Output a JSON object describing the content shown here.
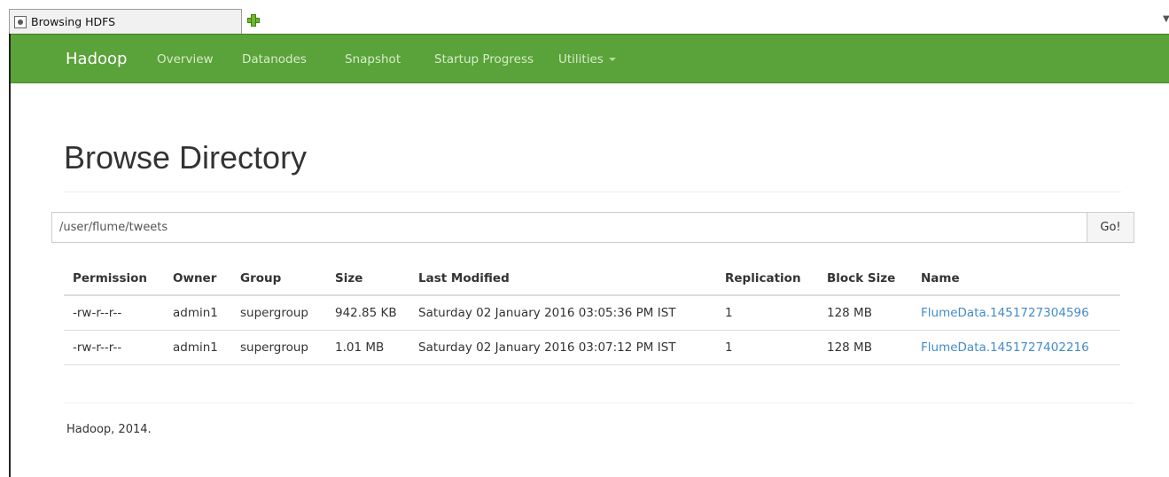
{
  "browser": {
    "tab_title": "Browsing HDFS",
    "menu_glyph": "▼"
  },
  "navbar": {
    "brand": "Hadoop",
    "color": "#5aa23a",
    "items": [
      "Overview",
      "Datanodes",
      "Snapshot",
      "Startup Progress",
      "Utilities"
    ]
  },
  "main": {
    "title": "Browse Directory",
    "path_value": "/user/flume/tweets",
    "go_label": "Go!"
  },
  "table": {
    "headers": [
      "Permission",
      "Owner",
      "Group",
      "Size",
      "Last Modified",
      "Replication",
      "Block Size",
      "Name"
    ],
    "rows": [
      {
        "permission": "-rw-r--r--",
        "owner": "admin1",
        "group": "supergroup",
        "size": "942.85 KB",
        "modified": "Saturday 02 January 2016 03:05:36 PM IST",
        "replication": "1",
        "block_size": "128 MB",
        "name": "FlumeData.1451727304596"
      },
      {
        "permission": "-rw-r--r--",
        "owner": "admin1",
        "group": "supergroup",
        "size": "1.01 MB",
        "modified": "Saturday 02 January 2016 03:07:12 PM IST",
        "replication": "1",
        "block_size": "128 MB",
        "name": "FlumeData.1451727402216"
      }
    ]
  },
  "footer": {
    "text": "Hadoop, 2014."
  }
}
